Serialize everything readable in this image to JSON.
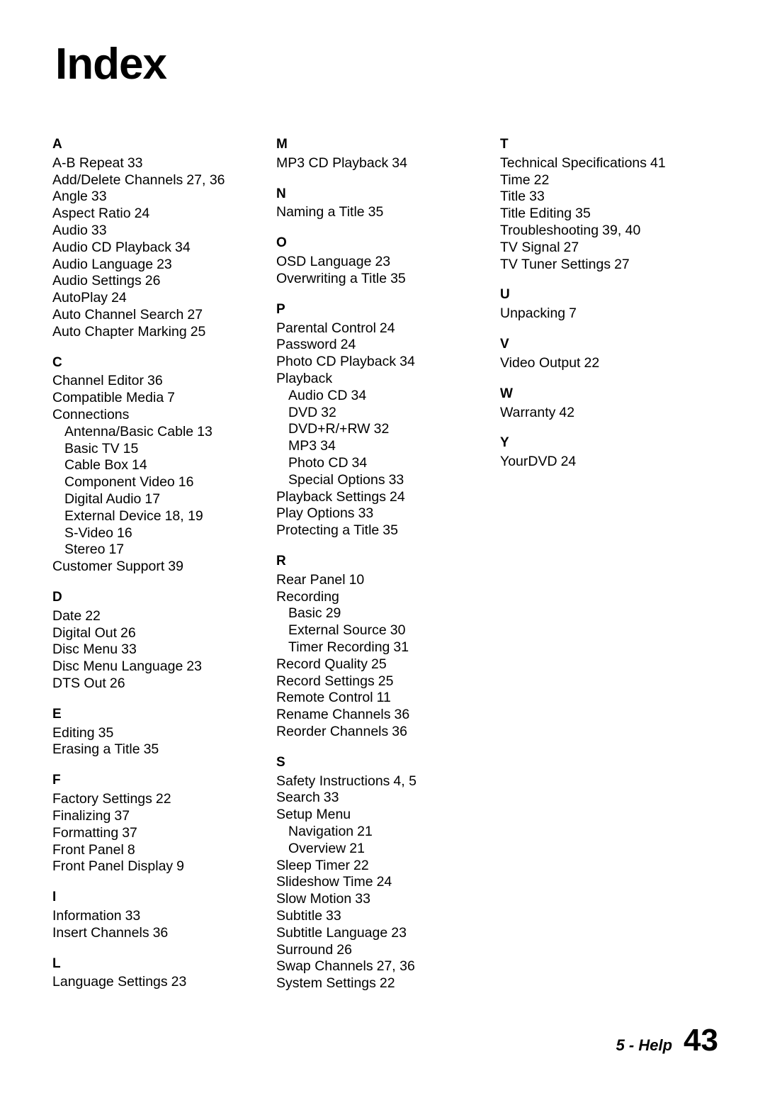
{
  "title": "Index",
  "footer": {
    "section": "5 - Help",
    "page_number": "43"
  },
  "columns": [
    {
      "groups": [
        {
          "letter": "A",
          "entries": [
            {
              "text": "A-B Repeat",
              "pages": "33",
              "sub": false
            },
            {
              "text": "Add/Delete Channels",
              "pages": "27, 36",
              "sub": false
            },
            {
              "text": "Angle",
              "pages": "33",
              "sub": false
            },
            {
              "text": "Aspect Ratio",
              "pages": "24",
              "sub": false
            },
            {
              "text": "Audio",
              "pages": "33",
              "sub": false
            },
            {
              "text": "Audio CD Playback",
              "pages": "34",
              "sub": false
            },
            {
              "text": "Audio Language",
              "pages": "23",
              "sub": false
            },
            {
              "text": "Audio Settings",
              "pages": "26",
              "sub": false
            },
            {
              "text": "AutoPlay",
              "pages": "24",
              "sub": false
            },
            {
              "text": "Auto Channel Search",
              "pages": "27",
              "sub": false
            },
            {
              "text": "Auto Chapter Marking",
              "pages": "25",
              "sub": false
            }
          ]
        },
        {
          "letter": "C",
          "entries": [
            {
              "text": "Channel Editor",
              "pages": "36",
              "sub": false
            },
            {
              "text": "Compatible Media",
              "pages": "7",
              "sub": false
            },
            {
              "text": "Connections",
              "pages": "",
              "sub": false
            },
            {
              "text": "Antenna/Basic Cable",
              "pages": "13",
              "sub": true
            },
            {
              "text": "Basic TV",
              "pages": "15",
              "sub": true
            },
            {
              "text": "Cable Box",
              "pages": "14",
              "sub": true
            },
            {
              "text": "Component Video",
              "pages": "16",
              "sub": true
            },
            {
              "text": "Digital Audio",
              "pages": "17",
              "sub": true
            },
            {
              "text": "External Device",
              "pages": "18, 19",
              "sub": true
            },
            {
              "text": "S-Video",
              "pages": "16",
              "sub": true
            },
            {
              "text": "Stereo",
              "pages": "17",
              "sub": true
            },
            {
              "text": "Customer Support",
              "pages": "39",
              "sub": false
            }
          ]
        },
        {
          "letter": "D",
          "entries": [
            {
              "text": "Date",
              "pages": "22",
              "sub": false
            },
            {
              "text": "Digital Out",
              "pages": "26",
              "sub": false
            },
            {
              "text": "Disc Menu",
              "pages": "33",
              "sub": false
            },
            {
              "text": "Disc Menu Language",
              "pages": "23",
              "sub": false
            },
            {
              "text": "DTS Out",
              "pages": "26",
              "sub": false
            }
          ]
        },
        {
          "letter": "E",
          "entries": [
            {
              "text": "Editing",
              "pages": "35",
              "sub": false
            },
            {
              "text": "Erasing a Title",
              "pages": "35",
              "sub": false
            }
          ]
        },
        {
          "letter": "F",
          "entries": [
            {
              "text": "Factory Settings",
              "pages": "22",
              "sub": false
            },
            {
              "text": "Finalizing",
              "pages": "37",
              "sub": false
            },
            {
              "text": "Formatting",
              "pages": "37",
              "sub": false
            },
            {
              "text": "Front Panel",
              "pages": "8",
              "sub": false
            },
            {
              "text": "Front Panel Display",
              "pages": "9",
              "sub": false
            }
          ]
        },
        {
          "letter": "I",
          "entries": [
            {
              "text": "Information",
              "pages": "33",
              "sub": false
            },
            {
              "text": "Insert Channels",
              "pages": "36",
              "sub": false
            }
          ]
        },
        {
          "letter": "L",
          "entries": [
            {
              "text": "Language Settings",
              "pages": "23",
              "sub": false
            }
          ]
        }
      ]
    },
    {
      "groups": [
        {
          "letter": "M",
          "entries": [
            {
              "text": "MP3 CD Playback",
              "pages": "34",
              "sub": false
            }
          ]
        },
        {
          "letter": "N",
          "entries": [
            {
              "text": "Naming a Title",
              "pages": "35",
              "sub": false
            }
          ]
        },
        {
          "letter": "O",
          "entries": [
            {
              "text": "OSD Language",
              "pages": "23",
              "sub": false
            },
            {
              "text": "Overwriting a Title",
              "pages": "35",
              "sub": false
            }
          ]
        },
        {
          "letter": "P",
          "entries": [
            {
              "text": "Parental Control",
              "pages": "24",
              "sub": false
            },
            {
              "text": "Password",
              "pages": "24",
              "sub": false
            },
            {
              "text": "Photo CD Playback",
              "pages": "34",
              "sub": false
            },
            {
              "text": "Playback",
              "pages": "",
              "sub": false
            },
            {
              "text": "Audio CD",
              "pages": "34",
              "sub": true
            },
            {
              "text": "DVD",
              "pages": "32",
              "sub": true
            },
            {
              "text": "DVD+R/+RW",
              "pages": "32",
              "sub": true
            },
            {
              "text": "MP3",
              "pages": "34",
              "sub": true
            },
            {
              "text": "Photo CD",
              "pages": "34",
              "sub": true
            },
            {
              "text": "Special Options",
              "pages": "33",
              "sub": true
            },
            {
              "text": "Playback Settings",
              "pages": "24",
              "sub": false
            },
            {
              "text": "Play Options",
              "pages": "33",
              "sub": false
            },
            {
              "text": "Protecting a Title",
              "pages": "35",
              "sub": false
            }
          ]
        },
        {
          "letter": "R",
          "entries": [
            {
              "text": "Rear Panel",
              "pages": "10",
              "sub": false
            },
            {
              "text": "Recording",
              "pages": "",
              "sub": false
            },
            {
              "text": "Basic",
              "pages": "29",
              "sub": true
            },
            {
              "text": "External Source",
              "pages": "30",
              "sub": true
            },
            {
              "text": "Timer Recording",
              "pages": "31",
              "sub": true
            },
            {
              "text": "Record Quality",
              "pages": "25",
              "sub": false
            },
            {
              "text": "Record Settings",
              "pages": "25",
              "sub": false
            },
            {
              "text": "Remote Control",
              "pages": "11",
              "sub": false
            },
            {
              "text": "Rename Channels",
              "pages": "36",
              "sub": false
            },
            {
              "text": "Reorder Channels",
              "pages": "36",
              "sub": false
            }
          ]
        },
        {
          "letter": "S",
          "entries": [
            {
              "text": "Safety Instructions",
              "pages": "4, 5",
              "sub": false
            },
            {
              "text": "Search",
              "pages": "33",
              "sub": false
            },
            {
              "text": "Setup Menu",
              "pages": "",
              "sub": false
            },
            {
              "text": "Navigation",
              "pages": "21",
              "sub": true
            },
            {
              "text": "Overview",
              "pages": "21",
              "sub": true
            },
            {
              "text": "Sleep Timer",
              "pages": "22",
              "sub": false
            },
            {
              "text": "Slideshow Time",
              "pages": "24",
              "sub": false
            },
            {
              "text": "Slow Motion",
              "pages": "33",
              "sub": false
            },
            {
              "text": "Subtitle",
              "pages": "33",
              "sub": false
            },
            {
              "text": "Subtitle Language",
              "pages": "23",
              "sub": false
            },
            {
              "text": "Surround",
              "pages": "26",
              "sub": false
            },
            {
              "text": "Swap Channels",
              "pages": "27, 36",
              "sub": false
            },
            {
              "text": "System Settings",
              "pages": "22",
              "sub": false
            }
          ]
        }
      ]
    },
    {
      "groups": [
        {
          "letter": "T",
          "entries": [
            {
              "text": "Technical Specifications",
              "pages": "41",
              "sub": false
            },
            {
              "text": "Time",
              "pages": "22",
              "sub": false
            },
            {
              "text": "Title",
              "pages": "33",
              "sub": false
            },
            {
              "text": "Title Editing",
              "pages": "35",
              "sub": false
            },
            {
              "text": "Troubleshooting",
              "pages": "39, 40",
              "sub": false
            },
            {
              "text": "TV Signal",
              "pages": "27",
              "sub": false
            },
            {
              "text": "TV Tuner Settings",
              "pages": "27",
              "sub": false
            }
          ]
        },
        {
          "letter": "U",
          "entries": [
            {
              "text": "Unpacking",
              "pages": "7",
              "sub": false
            }
          ]
        },
        {
          "letter": "V",
          "entries": [
            {
              "text": "Video Output",
              "pages": "22",
              "sub": false
            }
          ]
        },
        {
          "letter": "W",
          "entries": [
            {
              "text": "Warranty",
              "pages": "42",
              "sub": false
            }
          ]
        },
        {
          "letter": "Y",
          "entries": [
            {
              "text": "YourDVD",
              "pages": "24",
              "sub": false
            }
          ]
        }
      ]
    }
  ]
}
